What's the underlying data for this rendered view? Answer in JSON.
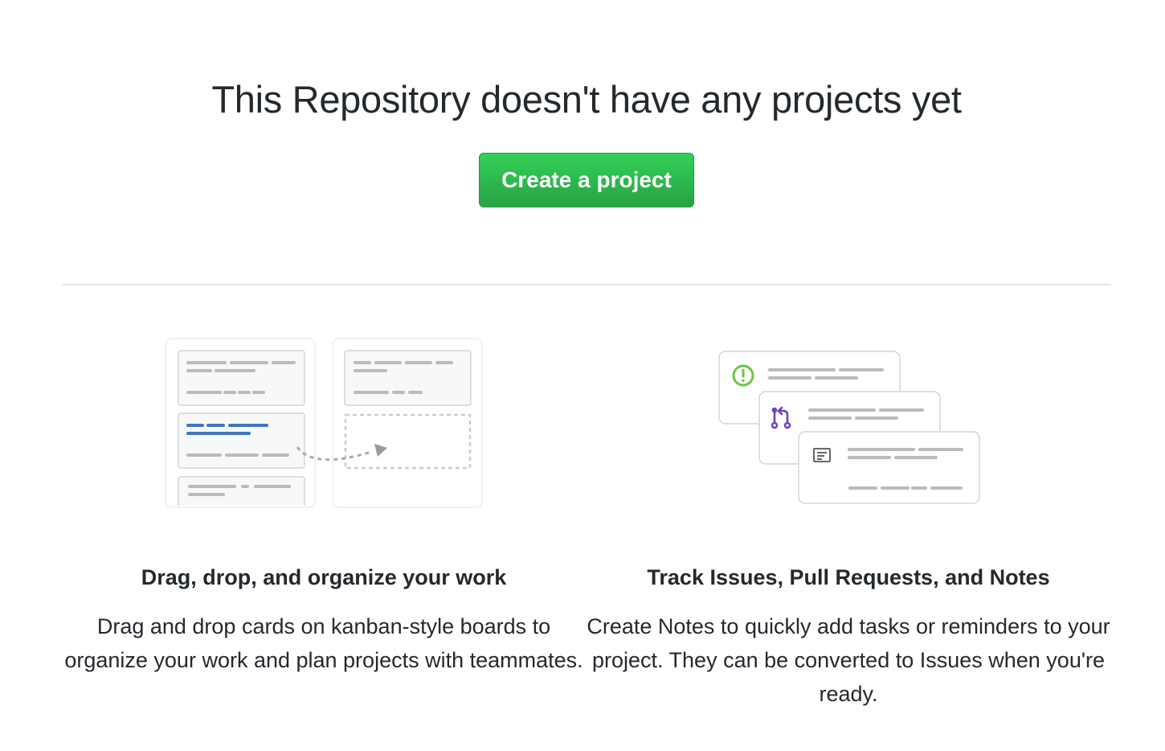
{
  "blankslate": {
    "title": "This Repository doesn't have any projects yet",
    "create_button_label": "Create a project"
  },
  "features": [
    {
      "title": "Drag, drop, and organize your work",
      "description": "Drag and drop cards on kanban-style boards to organize your work and plan projects with teammates.",
      "illustration": "kanban-board-illustration"
    },
    {
      "title": "Track Issues, Pull Requests, and Notes",
      "description": "Create Notes to quickly add tasks or reminders to your project. They can be converted to Issues when you're ready.",
      "illustration": "cards-illustration"
    }
  ],
  "colors": {
    "button_green": "#28a745",
    "issue_green": "#6cc644",
    "pull_request_purple": "#6f42c1",
    "card_blue": "#4078c0",
    "placeholder_gray": "#d1d5da"
  }
}
